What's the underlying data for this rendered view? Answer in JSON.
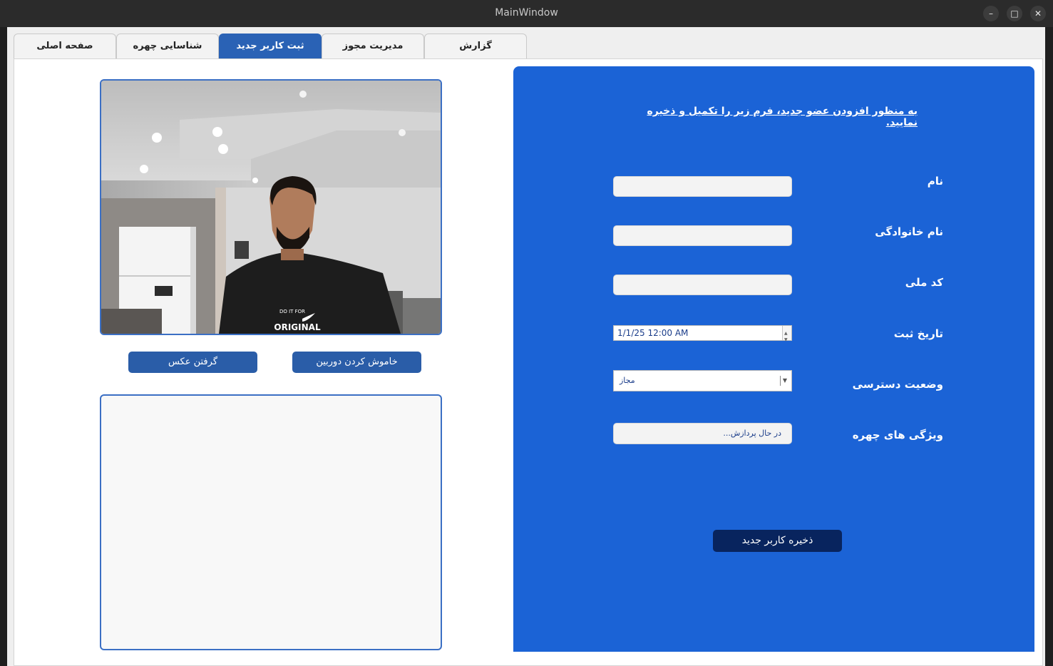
{
  "window": {
    "title": "MainWindow",
    "minimize_glyph": "–",
    "maximize_glyph": "□",
    "close_glyph": "✕"
  },
  "tabs": [
    {
      "label": "گزارش",
      "active": false
    },
    {
      "label": "مدیریت مجوز",
      "active": false
    },
    {
      "label": "ثبت کاربر جدید",
      "active": true
    },
    {
      "label": "شناسایی چهره",
      "active": false
    },
    {
      "label": "صفحه اصلی",
      "active": false
    }
  ],
  "camera": {
    "feed_image": "webcam-live-feed-person",
    "shirt_text_top": "DO IT FOR",
    "shirt_text_bottom": "ORIGINAL"
  },
  "buttons": {
    "camera_off": "خاموش کردن دوربین",
    "take_photo": "گرفتن عکس",
    "save_user": "ذخیره کاربر جدید"
  },
  "form": {
    "heading": "به منظور افزودن عضو جدید، فرم زیر را تکمیل و ذخیره نمایید.",
    "first_name_label": "نام",
    "first_name_value": "",
    "last_name_label": "نام خانوادگی",
    "last_name_value": "",
    "national_code_label": "کد ملی",
    "national_code_value": "",
    "reg_date_label": "تاریخ ثبت",
    "reg_date_value": "1/1/25 12:00 AM",
    "access_status_label": "وضعیت دسترسی",
    "access_status_value": "مجاز",
    "face_features_label": "ویژگی های چهره",
    "face_features_value": "در حال پردازش..."
  },
  "colors": {
    "active_tab": "#2a62b5",
    "form_panel": "#1b63d6",
    "save_button": "#08245e",
    "button": "#2a5da8"
  }
}
